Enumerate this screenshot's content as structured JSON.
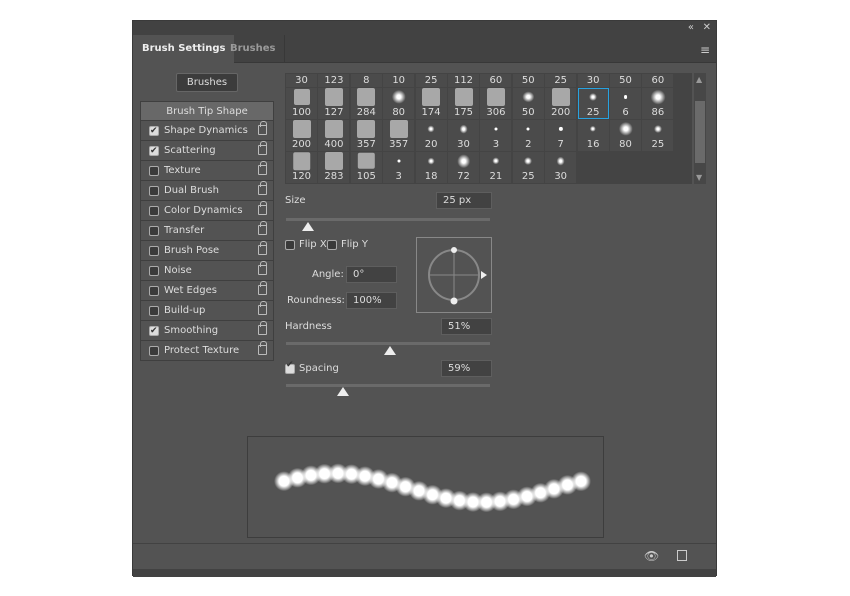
{
  "window": {
    "collapse_icon": "double-chevron-left-icon",
    "close_icon": "close-icon",
    "menu_icon": "hamburger-menu-icon"
  },
  "tabs": [
    {
      "label": "Brush Settings",
      "active": true
    },
    {
      "label": "Brushes",
      "active": false
    }
  ],
  "brushes_button": "Brushes",
  "sidebar": {
    "items": [
      {
        "label": "Brush Tip Shape"
      },
      {
        "label": "Shape Dynamics",
        "checked": true
      },
      {
        "label": "Scattering",
        "checked": true
      },
      {
        "label": "Texture",
        "checked": false
      },
      {
        "label": "Dual Brush",
        "checked": false
      },
      {
        "label": "Color Dynamics",
        "checked": false
      },
      {
        "label": "Transfer",
        "checked": false
      },
      {
        "label": "Brush Pose",
        "checked": false
      },
      {
        "label": "Noise",
        "checked": false
      },
      {
        "label": "Wet Edges",
        "checked": false
      },
      {
        "label": "Build-up",
        "checked": false
      },
      {
        "label": "Smoothing",
        "checked": true
      },
      {
        "label": "Protect Texture",
        "checked": false
      }
    ]
  },
  "brush_grid": {
    "header_sizes": [
      "30",
      "123",
      "8",
      "10",
      "25",
      "112",
      "60",
      "50",
      "25",
      "30",
      "50",
      "60"
    ],
    "rows": [
      [
        "100",
        "127",
        "284",
        "80",
        "174",
        "175",
        "306",
        "50",
        "200",
        "25",
        "6",
        "86"
      ],
      [
        "200",
        "400",
        "357",
        "357",
        "20",
        "30",
        "3",
        "2",
        "7",
        "16",
        "80",
        "25"
      ],
      [
        "120",
        "283",
        "105",
        "3",
        "18",
        "72",
        "21",
        "25",
        "30"
      ]
    ],
    "selected": "25",
    "accent": "#27a2e0"
  },
  "tip": {
    "size_label": "Size",
    "size_value": "25 px",
    "size_fraction": 0.11,
    "flip_x": "Flip X",
    "flip_y": "Flip Y",
    "angle_label": "Angle:",
    "angle_value": "0°",
    "roundness_label": "Roundness:",
    "roundness_value": "100%",
    "hardness_label": "Hardness",
    "hardness_value": "51%",
    "hardness_fraction": 0.51,
    "spacing_label": "Spacing",
    "spacing_checked": true,
    "spacing_value": "59%",
    "spacing_fraction": 0.28
  },
  "footer": {
    "icons": [
      "eye-toggle-icon",
      "new-preset-icon"
    ]
  }
}
